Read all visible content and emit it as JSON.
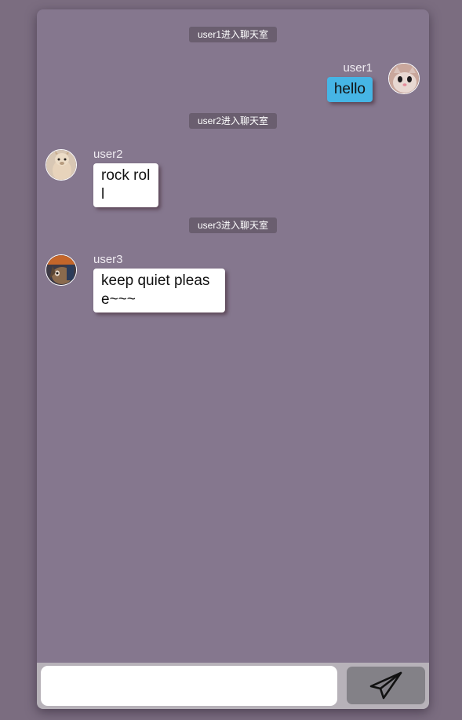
{
  "messages": {
    "system_notices": [
      {
        "text": "user1进入聊天室"
      },
      {
        "text": "user2进入聊天室"
      },
      {
        "text": "user3进入聊天室"
      }
    ],
    "chat": [
      {
        "username": "user1",
        "text": "hello",
        "side": "self"
      },
      {
        "username": "user2",
        "text": "rock roll",
        "side": "other"
      },
      {
        "username": "user3",
        "text": "keep quiet please~~~",
        "side": "other"
      }
    ]
  },
  "composer": {
    "input_value": "",
    "send_icon": "paper-plane-icon"
  },
  "colors": {
    "page_background": "#7b6d80",
    "chat_background": "#85778e",
    "self_bubble": "#46b5e5",
    "other_bubble": "#ffffff",
    "notice_background": "#6a5e6f",
    "send_button": "#838187"
  }
}
